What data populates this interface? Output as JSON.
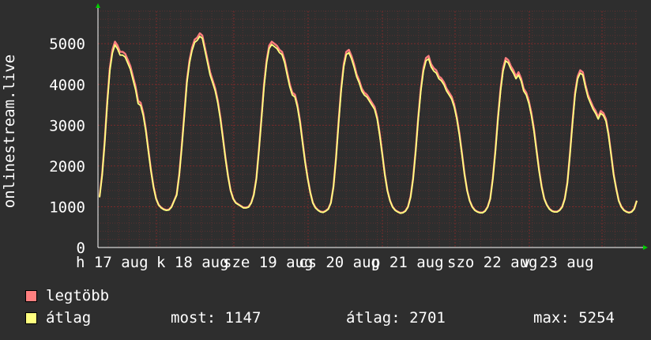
{
  "chart_data": {
    "type": "line",
    "ylabel": "onlinestream.live",
    "ylim": [
      0,
      5800
    ],
    "yticks": [
      0,
      1000,
      2000,
      3000,
      4000,
      5000
    ],
    "xticks": [
      "h 17 aug",
      "k 18 aug",
      "sze 19 aug",
      "cs 20 aug",
      "p 21 aug",
      "szo 22 aug",
      "v 23 aug"
    ],
    "grid": true,
    "series": [
      {
        "name": "legtöbb",
        "color": "#ff7f7f",
        "values": [
          1250,
          1800,
          2600,
          3600,
          4400,
          4850,
          5050,
          4950,
          4800,
          4800,
          4750,
          4600,
          4450,
          4200,
          3950,
          3600,
          3550,
          3300,
          2900,
          2400,
          1900,
          1500,
          1200,
          1050,
          980,
          940,
          920,
          930,
          1000,
          1150,
          1300,
          1800,
          2500,
          3300,
          4100,
          4600,
          4900,
          5100,
          5150,
          5254,
          5200,
          4900,
          4600,
          4300,
          4100,
          3900,
          3600,
          3200,
          2700,
          2200,
          1750,
          1400,
          1200,
          1100,
          1060,
          1020,
          980,
          980,
          1000,
          1100,
          1300,
          1700,
          2400,
          3200,
          4000,
          4600,
          4950,
          5050,
          5000,
          4950,
          4850,
          4800,
          4600,
          4300,
          4000,
          3800,
          3750,
          3500,
          3100,
          2600,
          2100,
          1700,
          1350,
          1100,
          980,
          920,
          880,
          870,
          900,
          950,
          1100,
          1500,
          2200,
          3100,
          3900,
          4500,
          4800,
          4850,
          4700,
          4500,
          4250,
          4100,
          3900,
          3800,
          3750,
          3650,
          3550,
          3450,
          3200,
          2800,
          2300,
          1800,
          1400,
          1150,
          1000,
          920,
          880,
          850,
          860,
          900,
          1000,
          1250,
          1700,
          2400,
          3200,
          3900,
          4400,
          4650,
          4700,
          4500,
          4400,
          4350,
          4200,
          4150,
          4050,
          3900,
          3800,
          3700,
          3500,
          3200,
          2800,
          2300,
          1800,
          1400,
          1150,
          1000,
          920,
          880,
          860,
          860,
          900,
          1000,
          1200,
          1700,
          2400,
          3200,
          3900,
          4400,
          4650,
          4600,
          4450,
          4350,
          4200,
          4300,
          4150,
          3900,
          3800,
          3600,
          3300,
          2900,
          2400,
          1900,
          1500,
          1200,
          1050,
          950,
          900,
          880,
          880,
          920,
          1000,
          1200,
          1600,
          2300,
          3100,
          3800,
          4200,
          4350,
          4300,
          4000,
          3750,
          3600,
          3450,
          3350,
          3200,
          3350,
          3300,
          3150,
          2800,
          2300,
          1800,
          1450,
          1150,
          1000,
          920,
          880,
          860,
          880,
          950,
          1150
        ]
      },
      {
        "name": "átlag",
        "color": "#ffff7f",
        "values": [
          1230,
          1770,
          2560,
          3540,
          4330,
          4770,
          4970,
          4870,
          4720,
          4720,
          4670,
          4520,
          4370,
          4120,
          3870,
          3530,
          3480,
          3240,
          2850,
          2360,
          1870,
          1480,
          1190,
          1040,
          970,
          930,
          910,
          920,
          990,
          1140,
          1280,
          1770,
          2460,
          3250,
          4040,
          4530,
          4830,
          5030,
          5080,
          5180,
          5130,
          4830,
          4530,
          4230,
          4040,
          3840,
          3540,
          3150,
          2660,
          2170,
          1730,
          1390,
          1190,
          1090,
          1050,
          1010,
          970,
          970,
          990,
          1090,
          1280,
          1680,
          2360,
          3150,
          3940,
          4530,
          4880,
          4980,
          4930,
          4880,
          4780,
          4730,
          4530,
          4230,
          3940,
          3740,
          3690,
          3440,
          3050,
          2560,
          2070,
          1680,
          1340,
          1090,
          970,
          910,
          870,
          860,
          890,
          940,
          1090,
          1480,
          2170,
          3050,
          3840,
          4430,
          4730,
          4780,
          4630,
          4430,
          4190,
          4040,
          3840,
          3740,
          3690,
          3590,
          3490,
          3390,
          3150,
          2750,
          2270,
          1780,
          1390,
          1140,
          990,
          910,
          870,
          840,
          850,
          890,
          990,
          1230,
          1680,
          2360,
          3150,
          3840,
          4330,
          4580,
          4630,
          4430,
          4330,
          4280,
          4140,
          4090,
          3990,
          3840,
          3740,
          3640,
          3440,
          3150,
          2750,
          2270,
          1780,
          1390,
          1140,
          990,
          910,
          870,
          850,
          850,
          890,
          990,
          1190,
          1680,
          2360,
          3150,
          3840,
          4330,
          4580,
          4530,
          4380,
          4280,
          4140,
          4230,
          4090,
          3840,
          3740,
          3540,
          3240,
          2850,
          2360,
          1870,
          1480,
          1190,
          1040,
          940,
          890,
          870,
          870,
          910,
          990,
          1190,
          1580,
          2270,
          3050,
          3740,
          4140,
          4280,
          4230,
          3940,
          3690,
          3540,
          3390,
          3290,
          3150,
          3290,
          3240,
          3100,
          2750,
          2270,
          1780,
          1430,
          1140,
          990,
          910,
          870,
          850,
          870,
          940,
          1147
        ]
      }
    ]
  },
  "legend": {
    "max_label": "legtöbb",
    "avg_label": "átlag",
    "now": "most: 1147",
    "average": "átlag: 2701",
    "maximum": "max: 5254",
    "max_color": "#ff7f7f",
    "avg_color": "#ffff7f"
  }
}
